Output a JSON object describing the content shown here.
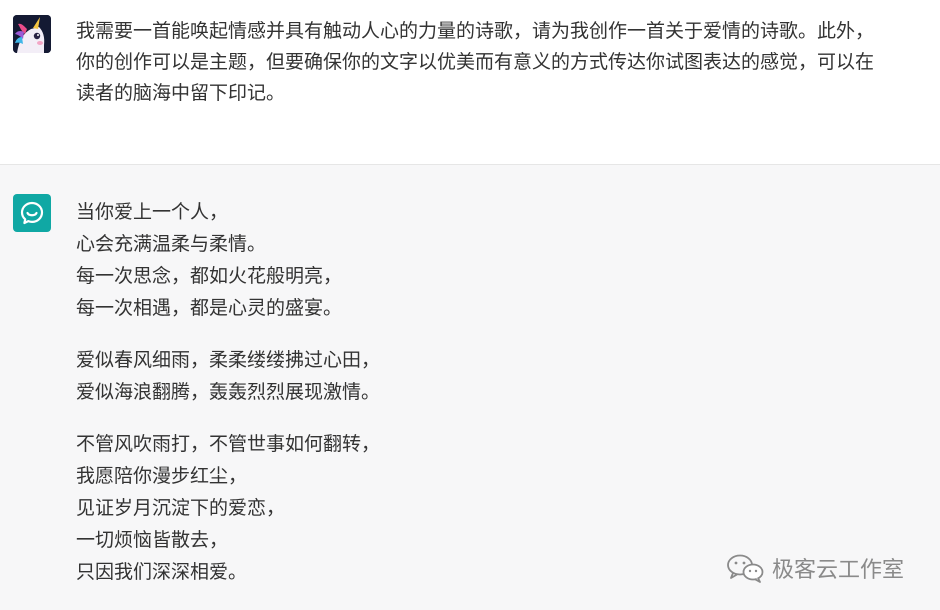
{
  "user_message": {
    "lines": [
      "我需要一首能唤起情感并具有触动人心的力量的诗歌，请为我创作一首关于爱情的诗歌。此外，",
      "你的创作可以是主题，但要确保你的文字以优美而有意义的方式传达你试图表达的感觉，可以在",
      "读者的脑海中留下印记。"
    ]
  },
  "assistant_message": {
    "stanzas": [
      [
        "当你爱上一个人，",
        "心会充满温柔与柔情。",
        "每一次思念，都如火花般明亮，",
        "每一次相遇，都是心灵的盛宴。"
      ],
      [
        "爱似春风细雨，柔柔缕缕拂过心田，",
        "爱似海浪翻腾，轰轰烈烈展现激情。"
      ],
      [
        "不管风吹雨打，不管世事如何翻转，",
        "我愿陪你漫步红尘，",
        "见证岁月沉淀下的爱恋，",
        "一切烦恼皆散去，",
        "只因我们深深相爱。"
      ]
    ]
  },
  "watermark": {
    "text": "极客云工作室",
    "icon": "wechat-icon"
  },
  "icons": {
    "user_avatar": "unicorn-avatar",
    "assistant_avatar": "assistant-logo-icon"
  },
  "colors": {
    "assistant_avatar_bg": "#10a8a4",
    "assistant_bg": "#f7f7f8",
    "text": "#333333"
  }
}
